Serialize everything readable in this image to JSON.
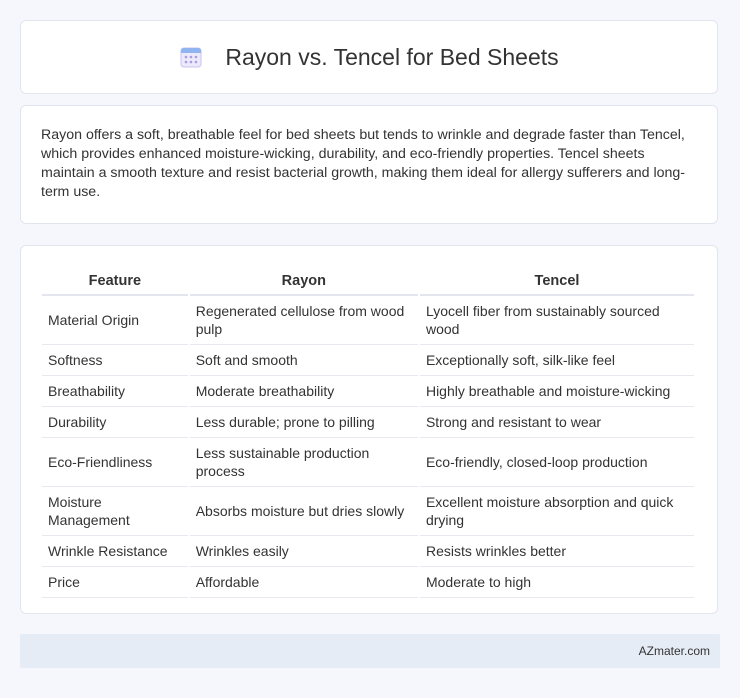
{
  "header": {
    "icon": "calendar-icon",
    "title": "Rayon vs. Tencel for Bed Sheets"
  },
  "summary": {
    "text": "Rayon offers a soft, breathable feel for bed sheets but tends to wrinkle and degrade faster than Tencel, which provides enhanced moisture-wicking, durability, and eco-friendly properties. Tencel sheets maintain a smooth texture and resist bacterial growth, making them ideal for allergy sufferers and long-term use."
  },
  "table": {
    "headers": [
      "Feature",
      "Rayon",
      "Tencel"
    ],
    "rows": [
      [
        "Material Origin",
        "Regenerated cellulose from wood pulp",
        "Lyocell fiber from sustainably sourced wood"
      ],
      [
        "Softness",
        "Soft and smooth",
        "Exceptionally soft, silk-like feel"
      ],
      [
        "Breathability",
        "Moderate breathability",
        "Highly breathable and moisture-wicking"
      ],
      [
        "Durability",
        "Less durable; prone to pilling",
        "Strong and resistant to wear"
      ],
      [
        "Eco-Friendliness",
        "Less sustainable production process",
        "Eco-friendly, closed-loop production"
      ],
      [
        "Moisture Management",
        "Absorbs moisture but dries slowly",
        "Excellent moisture absorption and quick drying"
      ],
      [
        "Wrinkle Resistance",
        "Wrinkles easily",
        "Resists wrinkles better"
      ],
      [
        "Price",
        "Affordable",
        "Moderate to high"
      ]
    ]
  },
  "footer": {
    "text": "AZmater.com"
  },
  "colors": {
    "background": "#f5f7fc",
    "card": "#ffffff",
    "footer": "#e6ecf6",
    "icon_accent": "#8b7fd6"
  }
}
